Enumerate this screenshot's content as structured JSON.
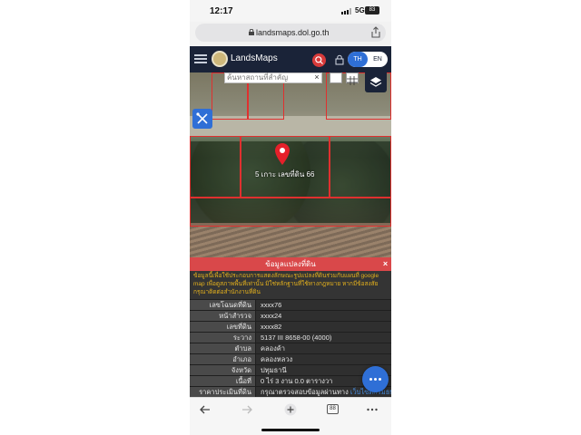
{
  "status": {
    "time": "12:17",
    "network": "5G",
    "battery": "83"
  },
  "browser": {
    "url": "landsmaps.dol.go.th",
    "tabs_count": "88"
  },
  "app": {
    "brand": "LandsMaps",
    "lang_th": "TH",
    "lang_en": "EN"
  },
  "map": {
    "search_placeholder": "ค้นหาสถานที่สำคัญ",
    "search_close": "×",
    "pin_label": "5 เกาะ เลขที่ดิน 66"
  },
  "panel": {
    "title": "ข้อมูลแปลงที่ดิน",
    "close": "×",
    "notice": "ข้อมูลนี้เพื่อใช้ประกอบการแสดงลักษณะรูปแปลงที่ดินร่วมกับแผนที่ google map เพื่อดูสภาพพื้นที่เท่านั้น มิใช่หลักฐานที่ใช้ทางกฎหมาย หากมีข้อสงสัย กรุณาติดต่อสำนักงานที่ดิน",
    "rows": [
      {
        "label": "เลขโฉนดที่ดิน",
        "value": "xxxx76"
      },
      {
        "label": "หน้าสำรวจ",
        "value": "xxxx24"
      },
      {
        "label": "เลขที่ดิน",
        "value": "xxxx82"
      },
      {
        "label": "ระวาง",
        "value": "5137 III 8658-00 (4000)"
      },
      {
        "label": "ตำบล",
        "value": "คลองค้า"
      },
      {
        "label": "อำเภอ",
        "value": "คลองหลวง"
      },
      {
        "label": "จังหวัด",
        "value": "ปทุมธานี"
      },
      {
        "label": "เนื้อที่",
        "value": "0 ไร่ 3 งาน 0.0 ตารางวา"
      },
      {
        "label": "ราคาประเมินที่ดิน",
        "value": "กรุณาตรวจสอบข้อมูลผ่านทาง",
        "link": "เว็บไซต์กรมธนารักษ์"
      }
    ]
  },
  "colors": {
    "header": "#1a2338",
    "accent": "#2f6fd6",
    "panel_title": "#d9484a",
    "notice_text": "#e3b01d"
  }
}
